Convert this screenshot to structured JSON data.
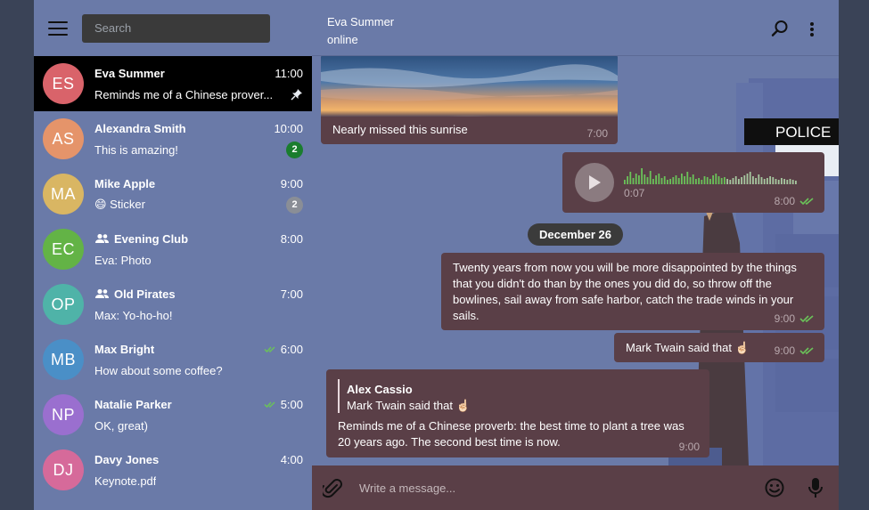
{
  "sidebar": {
    "search_placeholder": "Search",
    "chats": [
      {
        "initials": "ES",
        "name": "Eva Summer",
        "time": "11:00",
        "message": "Reminds me of a Chinese prover...",
        "color": "#d9636a",
        "pinned": true
      },
      {
        "initials": "AS",
        "name": "Alexandra Smith",
        "time": "10:00",
        "message": "This is amazing!",
        "color": "#e5946a",
        "badge": "2",
        "badge_color": "#1a7d2e"
      },
      {
        "initials": "MA",
        "name": "Mike Apple",
        "time": "9:00",
        "message": "😄 Sticker",
        "color": "#d9b663",
        "badge": "2",
        "badge_color": "#8a8e96"
      },
      {
        "initials": "EC",
        "name": "Evening Club",
        "time": "8:00",
        "message": "Eva: Photo",
        "color": "#63b346",
        "group": true
      },
      {
        "initials": "OP",
        "name": "Old Pirates",
        "time": "7:00",
        "message": "Max: Yo-ho-ho!",
        "color": "#4fb3a8",
        "group": true
      },
      {
        "initials": "MB",
        "name": "Max Bright",
        "time": "6:00",
        "message": "How about some coffee?",
        "color": "#4a8fc7",
        "read": true
      },
      {
        "initials": "NP",
        "name": "Natalie Parker",
        "time": "5:00",
        "message": "OK, great)",
        "color": "#9a6fcf",
        "read": true
      },
      {
        "initials": "DJ",
        "name": "Davy Jones",
        "time": "4:00",
        "message": "Keynote.pdf",
        "color": "#d66a9a"
      }
    ]
  },
  "header": {
    "peer_name": "Eva Summer",
    "peer_status": "online"
  },
  "messages": {
    "photo_caption": "Nearly missed this sunrise",
    "photo_time": "7:00",
    "voice_duration": "0:07",
    "voice_time": "8:00",
    "date_label": "December 26",
    "quote_text": "Twenty years from now you will be more disappointed by the things that you didn't do than by the ones you did do, so throw off the bowlines, sail away from safe harbor, catch the trade winds in your sails.",
    "quote_time": "9:00",
    "twain_text": "Mark Twain said that ☝🏻",
    "twain_time": "9:00",
    "reply_author": "Alex Cassio",
    "reply_quoted": "Mark Twain said that ☝🏻",
    "reply_text": "Reminds me of a Chinese proverb: the best time to plant a tree was 20 years ago. The second best time is now.",
    "reply_time": "9:00",
    "sign_text": "POLICE"
  },
  "compose": {
    "placeholder": "Write a message..."
  },
  "colors": {
    "bubble": "#5a3f47",
    "sidebar": "#6a7aa8",
    "active": "#000000",
    "check": "#6ac259"
  }
}
